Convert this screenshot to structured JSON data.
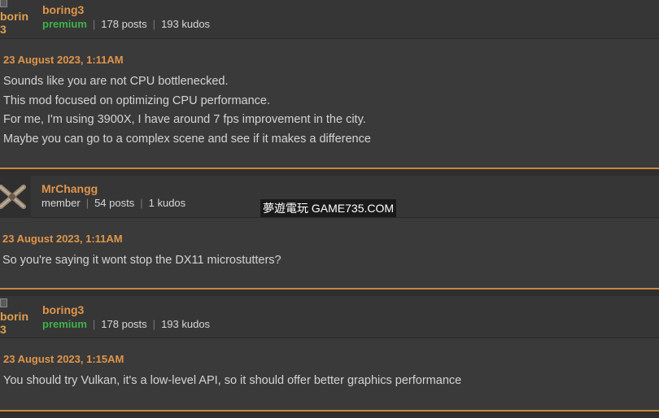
{
  "posts": [
    {
      "avatar_alt": "borin",
      "avatar_alt2": "3",
      "username": "boring3",
      "rank": "premium",
      "posts": "178 posts",
      "kudos": "193 kudos",
      "timestamp": "23 August 2023, 1:11AM",
      "lines": [
        "Sounds like you are not CPU bottlenecked.",
        "This mod focused on optimizing CPU performance.",
        "For me, I'm using 3900X, I have around 7 fps improvement in the city.",
        "Maybe you can go to a complex scene and see if it makes a difference"
      ]
    },
    {
      "username": "MrChangg",
      "rank": "member",
      "posts": "54 posts",
      "kudos": "1 kudos",
      "timestamp": "23 August 2023, 1:11AM",
      "lines": [
        "So you're saying it wont stop the DX11 microstutters?"
      ]
    },
    {
      "avatar_alt": "borin",
      "avatar_alt2": "3",
      "username": "boring3",
      "rank": "premium",
      "posts": "178 posts",
      "kudos": "193 kudos",
      "timestamp": "23 August 2023, 1:15AM",
      "lines": [
        "You should try Vulkan, it's a low-level API, so it should offer better graphics performance"
      ]
    }
  ],
  "watermark": "夢遊電玩 GAME735.COM",
  "colors": {
    "accent": "#e0954a",
    "premium": "#3fb24a",
    "separator": "#c8883a"
  }
}
